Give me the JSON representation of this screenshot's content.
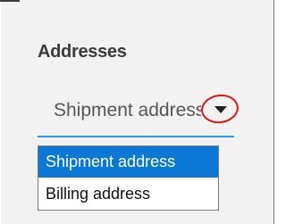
{
  "section": {
    "title": "Addresses"
  },
  "address_select": {
    "value": "Shipment address",
    "arrow_icon": "dropdown-arrow-icon",
    "annotation": "red-circle-highlight",
    "options": [
      {
        "label": "Shipment address",
        "selected": true
      },
      {
        "label": "Billing address",
        "selected": false
      }
    ]
  },
  "colors": {
    "accent": "#2d9cdb",
    "selection": "#0a78d4",
    "highlight": "#e01414",
    "panel": "#f2f2f2"
  }
}
